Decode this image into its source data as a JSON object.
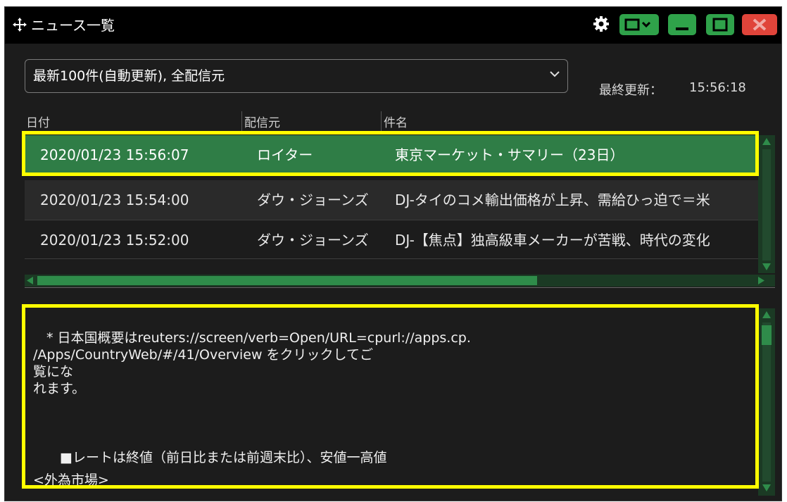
{
  "window": {
    "title": "ニュース一覧",
    "move_icon": "move-icon",
    "settings_icon": "gear-icon"
  },
  "filter": {
    "selected": "最新100件(自動更新), 全配信元"
  },
  "last_updated": {
    "label": "最終更新：",
    "time": "15:56:18"
  },
  "columns": [
    "日付",
    "配信元",
    "件名"
  ],
  "rows": [
    {
      "date": "2020/01/23 15:56:07",
      "source": "ロイター",
      "subject": "東京マーケット・サマリー（23日）"
    },
    {
      "date": "2020/01/23 15:54:00",
      "source": "ダウ・ジョーンズ",
      "subject": "DJ-タイのコメ輸出価格が上昇、需給ひっ迫で＝米"
    },
    {
      "date": "2020/01/23 15:52:00",
      "source": "ダウ・ジョーンズ",
      "subject": "DJ-【焦点】独高級車メーカーが苦戦、時代の変化"
    }
  ],
  "detail": {
    "lines": [
      "　* 日本国概要はreuters://screen/verb=Open/URL=cpurl://apps.cp.",
      "/Apps/CountryWeb/#/41/Overview をクリックしてご",
      "覧にな",
      "れます。",
      "",
      "",
      "　　■レートは終値（前日比または前週末比）、安値一高値",
      "<外為市場>"
    ]
  },
  "colors": {
    "accent_green": "#2fa24a",
    "selected_row": "#2f7d46",
    "close_red": "#e0443a",
    "highlight": "#ffff00"
  }
}
